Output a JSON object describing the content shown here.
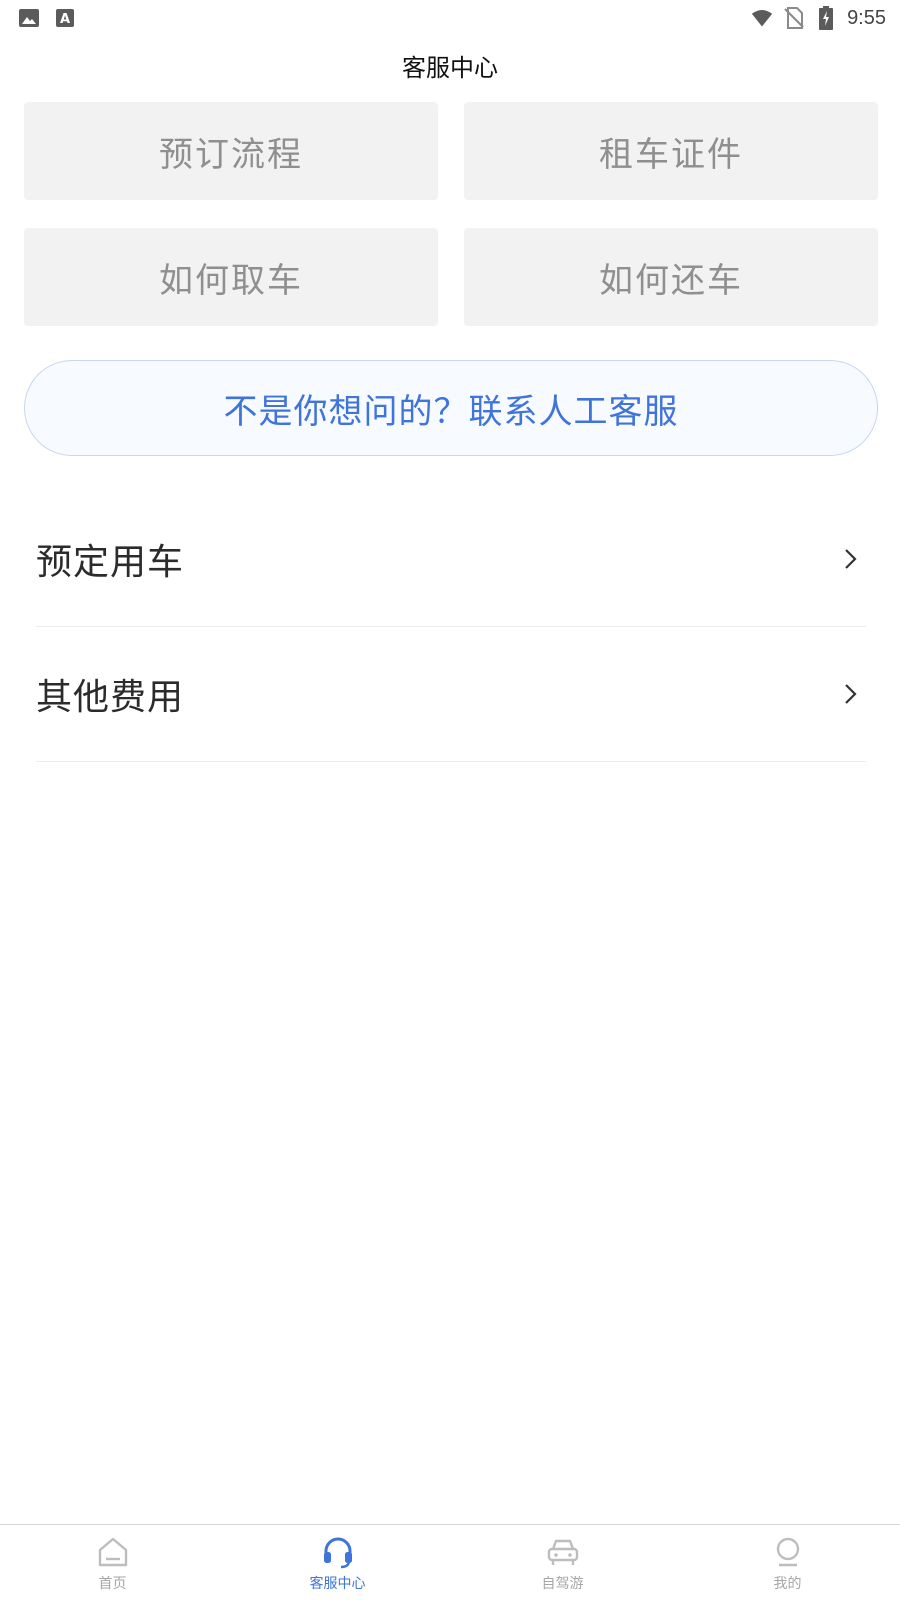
{
  "status_bar": {
    "time": "9:55",
    "left_icons": [
      "image-icon",
      "font-a-icon"
    ],
    "right_icons": [
      "wifi-icon",
      "no-sim-icon",
      "battery-charging-icon"
    ]
  },
  "header": {
    "title": "客服中心"
  },
  "quick_topics": [
    {
      "label": "预订流程"
    },
    {
      "label": "租车证件"
    },
    {
      "label": "如何取车"
    },
    {
      "label": "如何还车"
    }
  ],
  "contact": {
    "label": "不是你想问的？联系人工客服"
  },
  "faq": [
    {
      "label": "预定用车"
    },
    {
      "label": "其他费用"
    }
  ],
  "bottom_nav": [
    {
      "label": "首页",
      "icon": "home-icon",
      "active": false
    },
    {
      "label": "客服中心",
      "icon": "headset-icon",
      "active": true
    },
    {
      "label": "自驾游",
      "icon": "car-icon",
      "active": false
    },
    {
      "label": "我的",
      "icon": "profile-icon",
      "active": false
    }
  ],
  "colors": {
    "accent": "#3f74db",
    "quick_bg": "#f2f2f2",
    "quick_text": "#8f8f8f",
    "inactive_nav": "#a6a6a6"
  }
}
